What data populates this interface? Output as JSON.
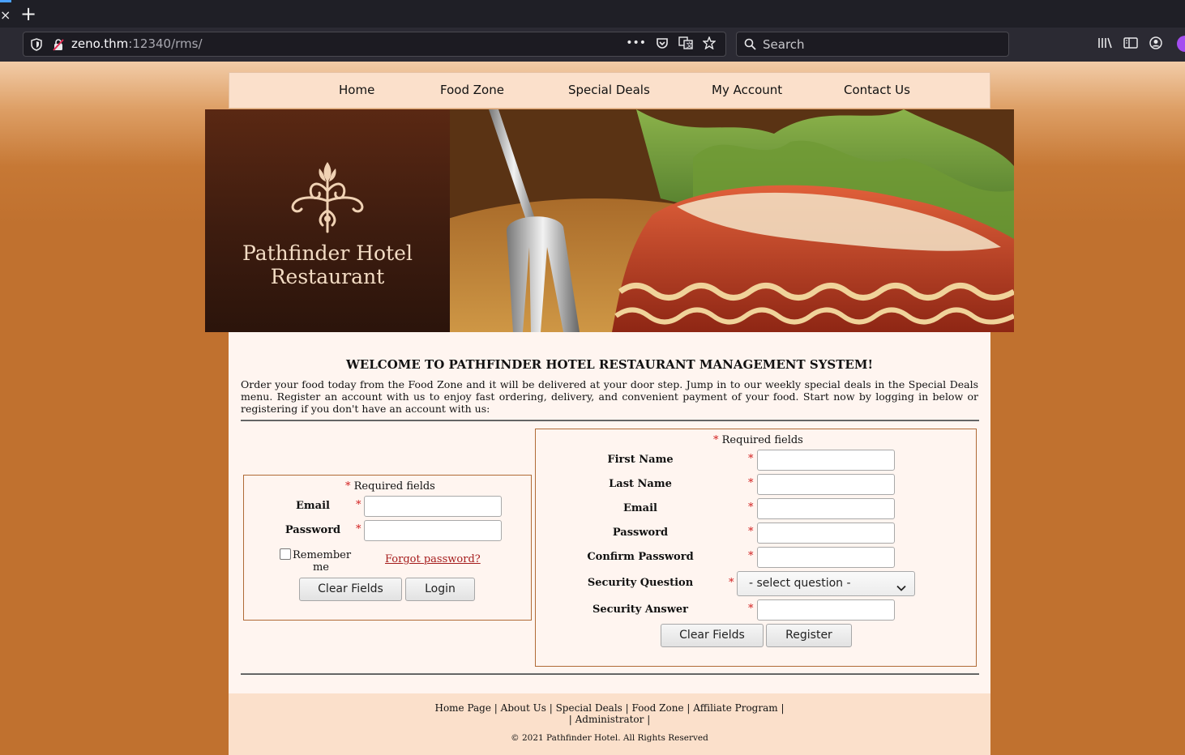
{
  "browser": {
    "url_host": "zeno.thm",
    "url_rest": ":12340/rms/",
    "search_placeholder": "Search",
    "new_tab_symbol": "+",
    "tab_close_symbol": "×"
  },
  "nav": {
    "items": [
      {
        "label": "Home"
      },
      {
        "label": "Food Zone"
      },
      {
        "label": "Special Deals"
      },
      {
        "label": "My Account"
      },
      {
        "label": "Contact Us"
      }
    ]
  },
  "header": {
    "brand_line1": "Pathfinder Hotel",
    "brand_line2": "Restaurant",
    "logo_icon": "fleur-ornament-icon",
    "photo_subject": "lasagna-photo"
  },
  "main": {
    "welcome": "WELCOME TO PATHFINDER HOTEL RESTAURANT MANAGEMENT SYSTEM!",
    "intro": "Order your food today from the Food Zone and it will be delivered at your door step. Jump in to our weekly special deals in the Special Deals menu. Register an account with us to enjoy fast ordering, delivery, and convenient payment of your food. Start now by logging in below or registering if you don't have an account with us:"
  },
  "login": {
    "required_note": "Required fields",
    "star": "*",
    "email_label": "Email",
    "password_label": "Password",
    "email_value": "",
    "password_value": "",
    "remember_label": "Remember me",
    "forgot_label": "Forgot password?",
    "clear_button": "Clear Fields",
    "login_button": "Login"
  },
  "register": {
    "required_note": "Required fields",
    "star": "*",
    "first_name_label": "First Name",
    "last_name_label": "Last Name",
    "email_label": "Email",
    "password_label": "Password",
    "confirm_password_label": "Confirm Password",
    "security_question_label": "Security Question",
    "security_answer_label": "Security Answer",
    "security_question_selected": "- select question -",
    "clear_button": "Clear Fields",
    "register_button": "Register"
  },
  "footer": {
    "links": [
      "Home Page",
      "About Us",
      "Special Deals",
      "Food Zone",
      "Affiliate Program",
      "Administrator"
    ],
    "separator": "|",
    "copyright": "© 2021 Pathfinder Hotel. All Rights Reserved"
  },
  "colors": {
    "page_orange": "#c0712f",
    "nav_bg": "#fbe0cb",
    "content_bg": "#fff5f0",
    "brand_brown": "#3d1c0f",
    "required_star": "#d21f1f",
    "link_red": "#a51c1c"
  }
}
